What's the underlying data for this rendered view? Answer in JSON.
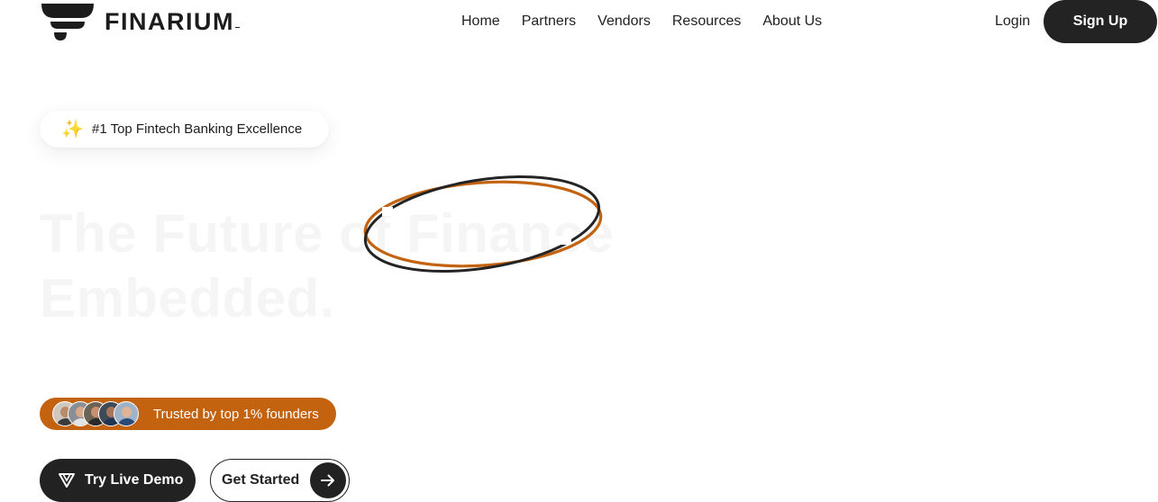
{
  "brand": {
    "name": "FINARIUM"
  },
  "nav": {
    "items": [
      {
        "label": "Home"
      },
      {
        "label": "Partners"
      },
      {
        "label": "Vendors"
      },
      {
        "label": "Resources"
      },
      {
        "label": "About Us"
      }
    ],
    "login": "Login",
    "signup": "Sign Up"
  },
  "hero": {
    "badge": {
      "icon": "sparkles-icon",
      "text": "#1 Top Fintech Banking Excellence"
    },
    "title_line1": "The Future of Finance",
    "title_line2": "Embedded.",
    "trusted_text": "Trusted by top 1% founders",
    "cta_demo": "Try Live Demo",
    "cta_start": "Get Started"
  },
  "colors": {
    "accent": "#c3620f",
    "dark": "#222222",
    "background": "#ffffff"
  }
}
